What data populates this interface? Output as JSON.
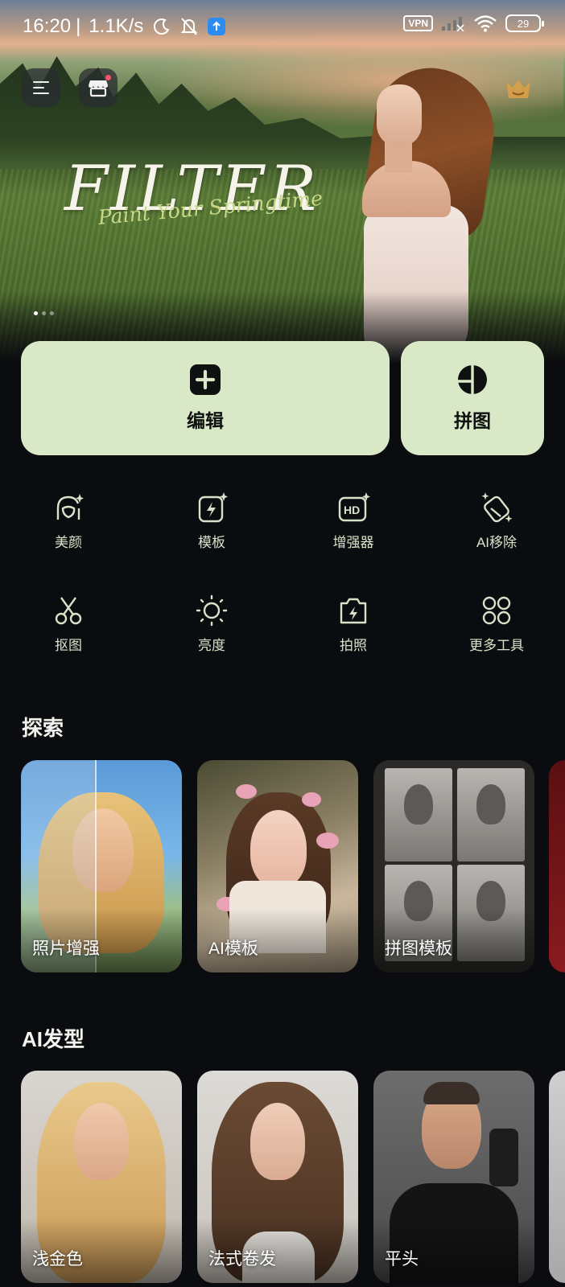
{
  "status_bar": {
    "time": "16:20",
    "net_speed": "1.1K/s",
    "vpn": "VPN",
    "battery": "29"
  },
  "hero": {
    "title": "FILTER",
    "subtitle": "Paint Your Springtime",
    "page_count": 3,
    "active_page": 1
  },
  "actions": {
    "edit_label": "编辑",
    "collage_label": "拼图"
  },
  "tools": [
    {
      "label": "美颜",
      "icon": "beauty-face-icon"
    },
    {
      "label": "模板",
      "icon": "template-icon"
    },
    {
      "label": "增强器",
      "icon": "hd-enhance-icon"
    },
    {
      "label": "AI移除",
      "icon": "eraser-icon"
    },
    {
      "label": "抠图",
      "icon": "scissors-icon"
    },
    {
      "label": "亮度",
      "icon": "sun-icon"
    },
    {
      "label": "拍照",
      "icon": "camera-icon"
    },
    {
      "label": "更多工具",
      "icon": "grid-icon"
    }
  ],
  "explore": {
    "title": "探索",
    "items": [
      {
        "label": "照片增强"
      },
      {
        "label": "AI模板"
      },
      {
        "label": "拼图模板"
      }
    ]
  },
  "hairstyle": {
    "title": "AI发型",
    "items": [
      {
        "label": "浅金色"
      },
      {
        "label": "法式卷发"
      },
      {
        "label": "平头"
      }
    ]
  },
  "colors": {
    "accent": "#d9e8c7",
    "background": "#0b0c0f",
    "tool_icon": "#d7e3c9",
    "notification_dot": "#ff4f6a"
  }
}
